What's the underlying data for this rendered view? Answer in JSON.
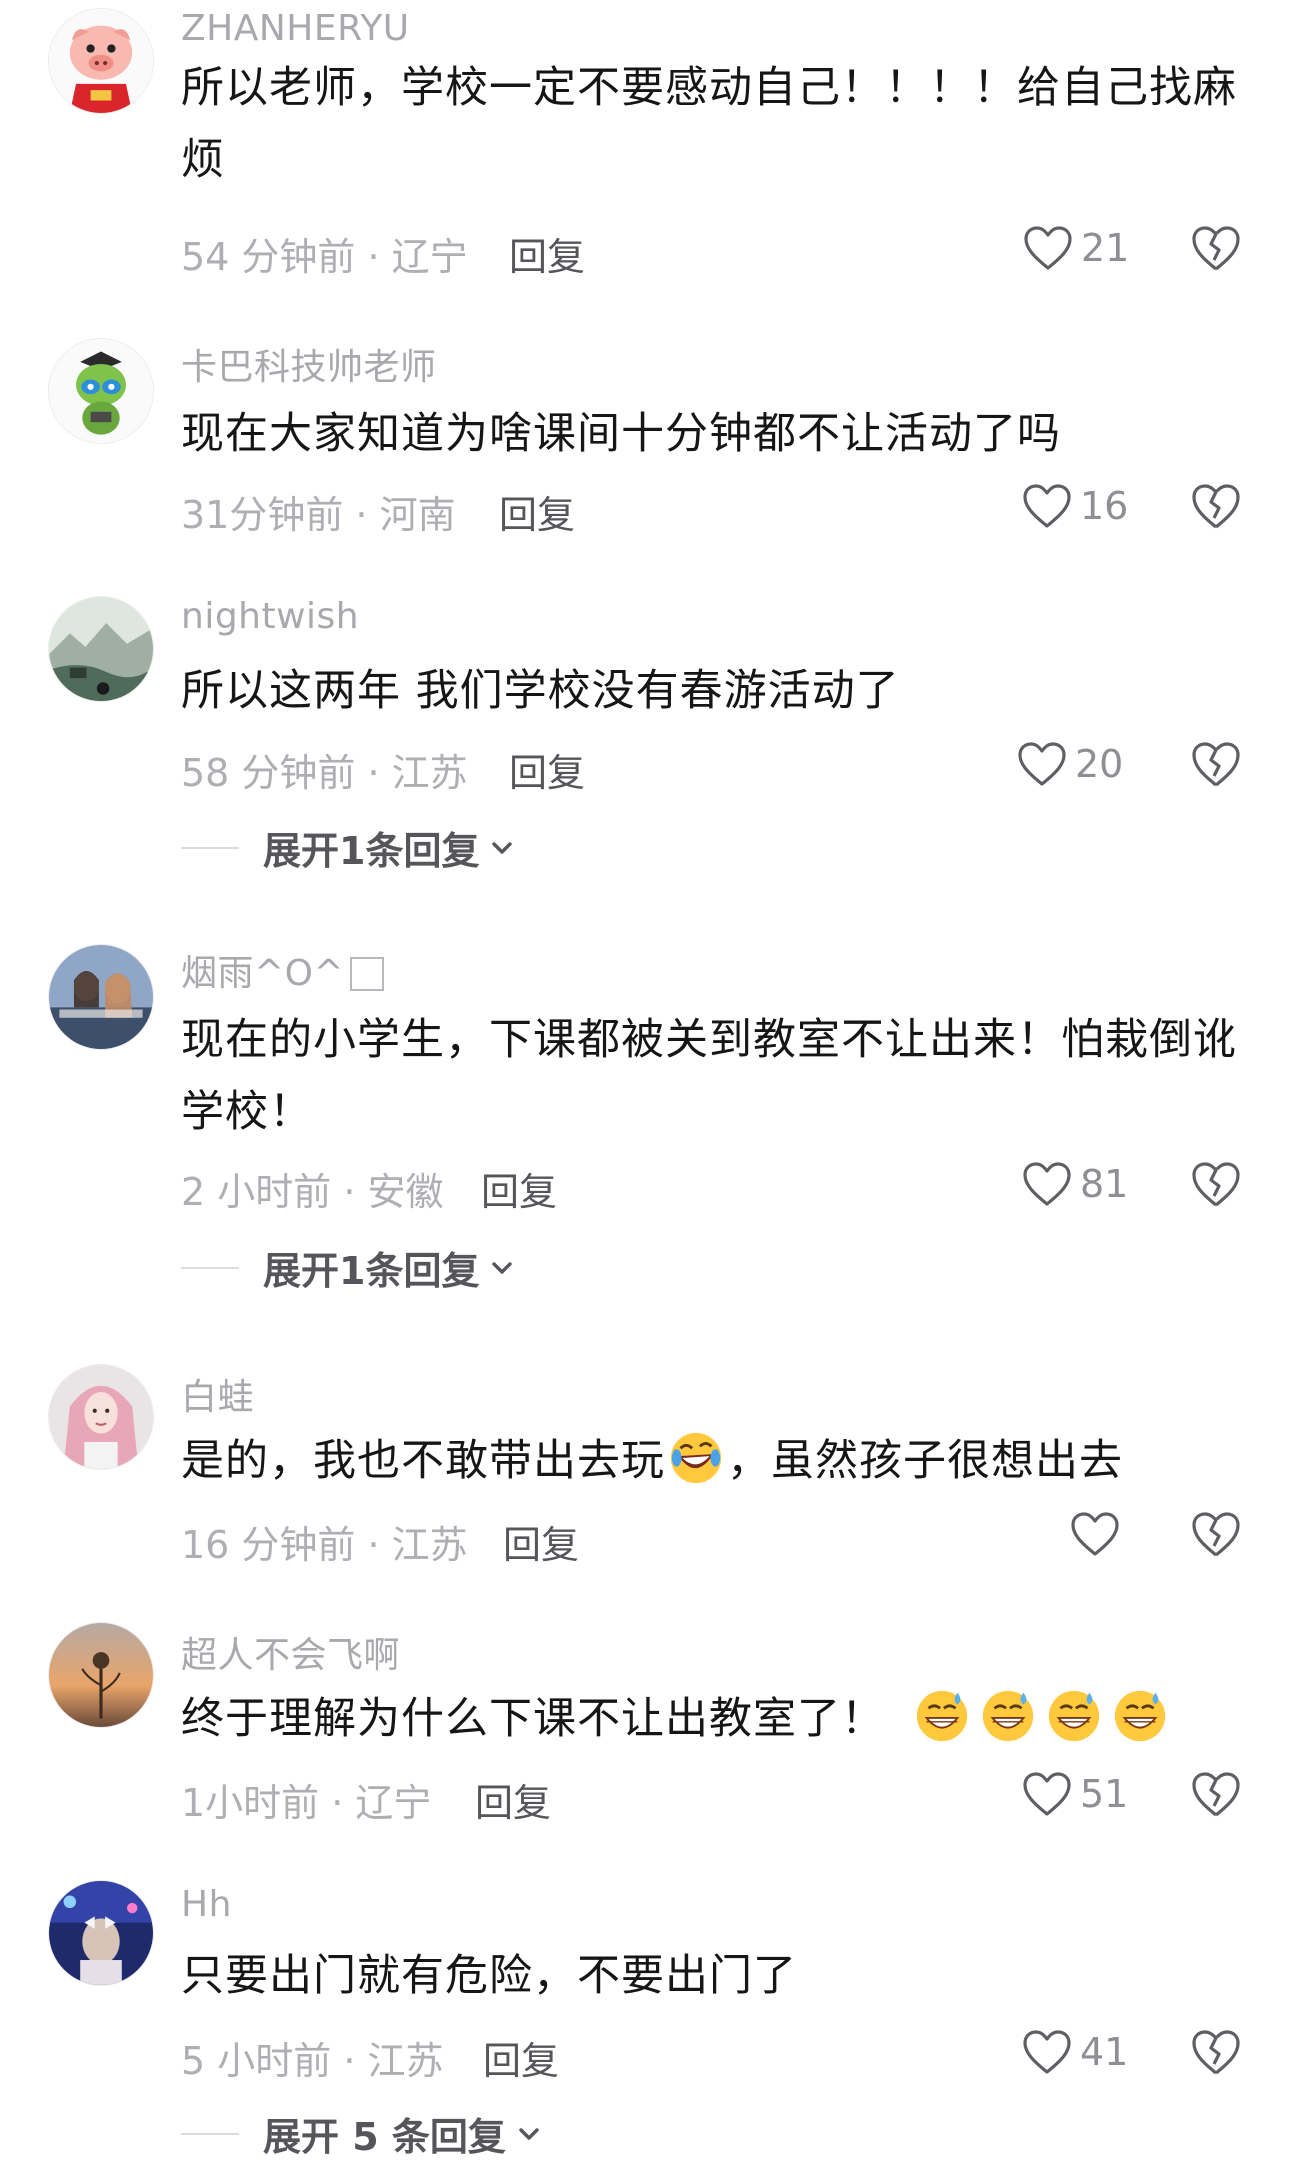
{
  "comments": [
    {
      "username": "ZHANHERYU",
      "text": "所以老师，学校一定不要感动自己！！！！给自己找麻烦",
      "time_location": "54 分钟前 · 辽宁",
      "reply_label": "回复",
      "likes": "21",
      "avatar": "cartoon-pig-avatar"
    },
    {
      "username": "卡巴科技帅老师",
      "text": "现在大家知道为啥课间十分钟都不让活动了吗",
      "time_location": "31分钟前 · 河南",
      "reply_label": "回复",
      "likes": "16",
      "avatar": "green-alien-graduate-avatar"
    },
    {
      "username": "nightwish",
      "text": "所以这两年 我们学校没有春游活动了",
      "time_location": "58 分钟前 · 江苏",
      "reply_label": "回复",
      "likes": "20",
      "avatar": "landscape-painting-avatar",
      "expand_label": "展开1条回复"
    },
    {
      "username": "烟雨^O^",
      "text": "现在的小学生，下课都被关到教室不让出来！怕栽倒讹学校！",
      "time_location": "2 小时前 · 安徽",
      "reply_label": "回复",
      "likes": "81",
      "avatar": "two-girls-photo-avatar",
      "expand_label": "展开1条回复"
    },
    {
      "username": "白蛙",
      "text_before_emoji": "是的，我也不敢带出去玩",
      "text_after_emoji": "，虽然孩子很想出去",
      "time_location": "16 分钟前 · 江苏",
      "reply_label": "回复",
      "likes": "",
      "avatar": "pink-hair-girl-avatar",
      "emoji": "rolling-laughing-emoji"
    },
    {
      "username": "超人不会飞啊",
      "text": "终于理解为什么下课不让出教室了！",
      "time_location": "1小时前 · 辽宁",
      "reply_label": "回复",
      "likes": "51",
      "avatar": "sunset-flower-avatar",
      "emoji": "grinning-sweat-emoji"
    },
    {
      "username": "Hh",
      "text": "只要出门就有危险，不要出门了",
      "time_location": "5 小时前 · 江苏",
      "reply_label": "回复",
      "likes": "41",
      "avatar": "girl-with-bow-avatar",
      "expand_label": "展开 5 条回复"
    }
  ],
  "colors": {
    "username": "#a8a8ad",
    "text": "#161616",
    "meta": "#aeaeb3",
    "reply": "#55555a",
    "icon_stroke": "#5e5e63"
  },
  "icons": {
    "like": "heart-outline-icon",
    "dislike": "broken-heart-outline-icon",
    "expand": "chevron-down-icon"
  }
}
